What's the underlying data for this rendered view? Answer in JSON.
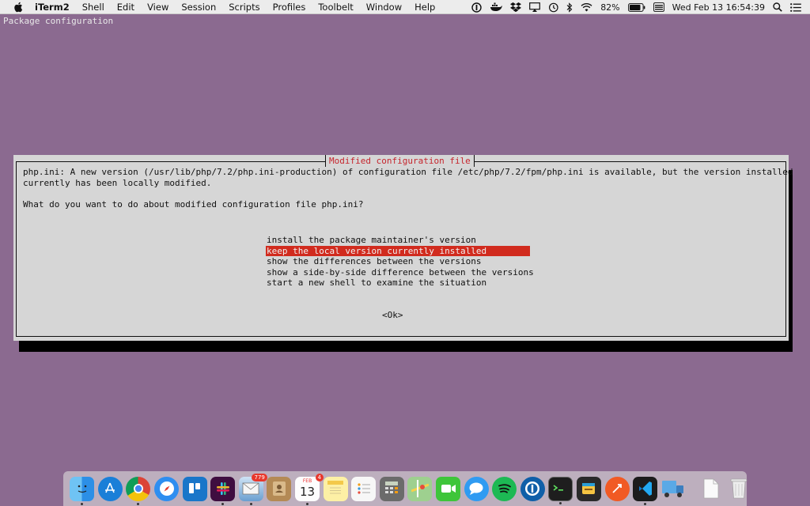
{
  "menubar": {
    "app_name": "iTerm2",
    "menus": [
      "Shell",
      "Edit",
      "View",
      "Session",
      "Scripts",
      "Profiles",
      "Toolbelt",
      "Window",
      "Help"
    ],
    "battery": "82%",
    "clock": "Wed Feb 13  16:54:39"
  },
  "terminal": {
    "title": "Package configuration",
    "dialog": {
      "title": "Modified configuration file",
      "message_line1": "php.ini: A new version (/usr/lib/php/7.2/php.ini-production) of configuration file /etc/php/7.2/fpm/php.ini is available, but the version installed",
      "message_line2": "currently has been locally modified.",
      "question": "What do you want to do about modified configuration file php.ini?",
      "options": [
        "install the package maintainer's version",
        "keep the local version currently installed",
        "show the differences between the versions",
        "show a side-by-side difference between the versions",
        "start a new shell to examine the situation"
      ],
      "selected_index": 1,
      "ok_label": "<Ok>"
    }
  },
  "dock": {
    "mail_badge": "779",
    "calendar_badge": "4",
    "calendar_month": "FEB",
    "calendar_day": "13",
    "accent_selected": "#d12b1e"
  }
}
